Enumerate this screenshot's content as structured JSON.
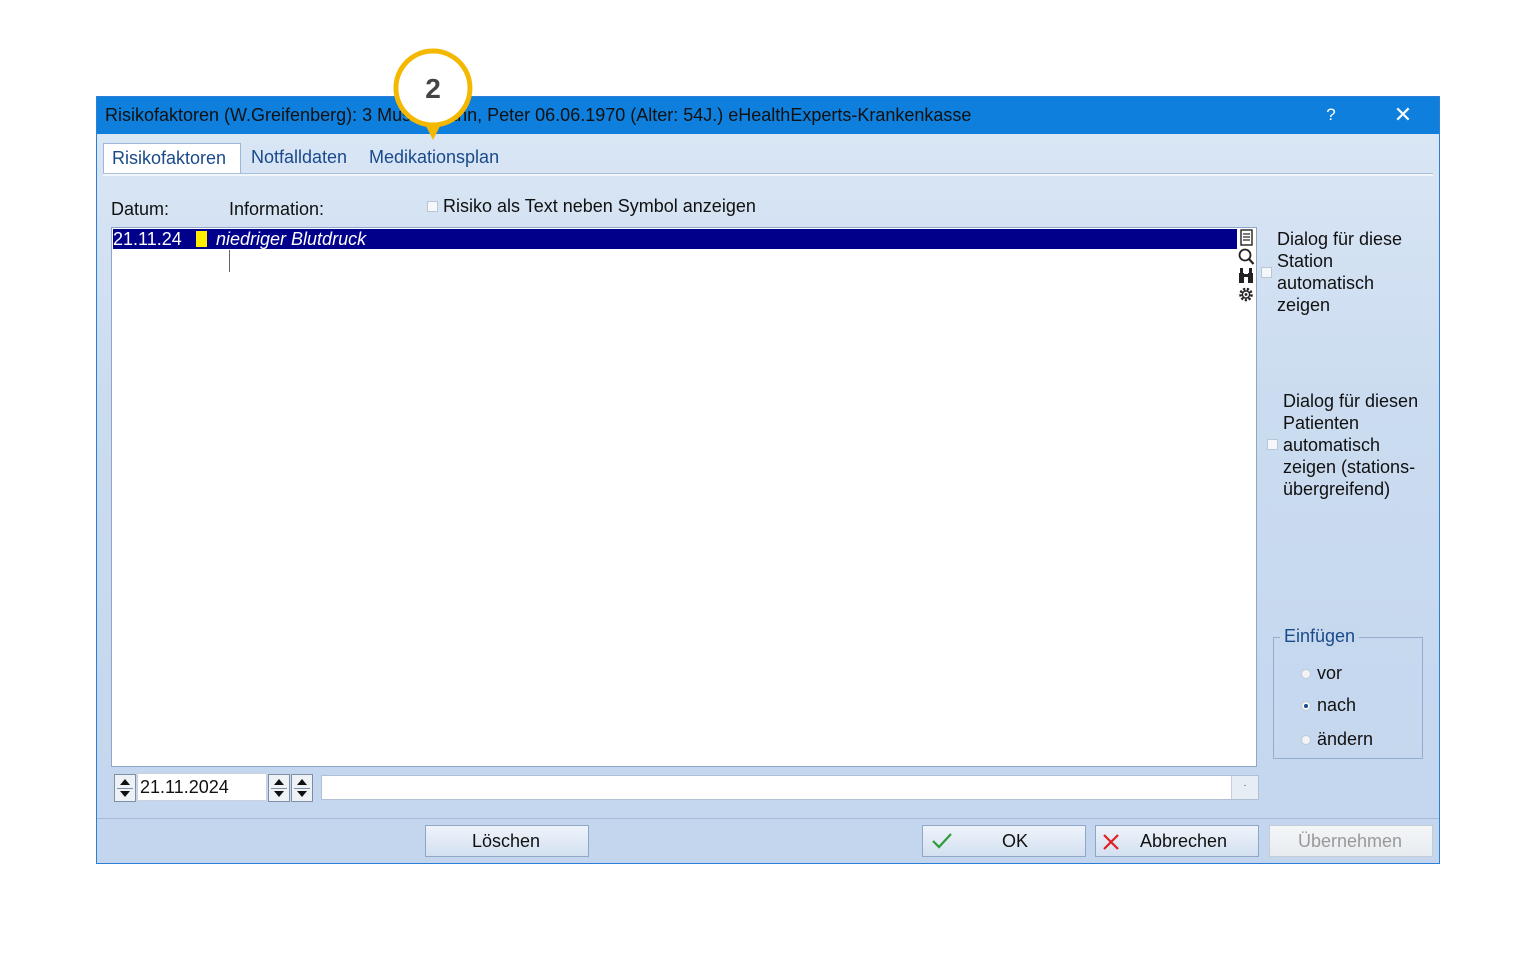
{
  "window": {
    "title": "Risikofaktoren (W.Greifenberg): 3  Mustermann, Peter 06.06.1970  (Alter: 54J.)  eHealthExperts-Krankenkasse",
    "help_label": "?",
    "close_label": "✕"
  },
  "tabs": [
    {
      "label": "Risikofaktoren",
      "active": true
    },
    {
      "label": "Notfalldaten",
      "active": false
    },
    {
      "label": "Medikationsplan",
      "active": false
    }
  ],
  "columns": {
    "date_label": "Datum:",
    "info_label": "Information:"
  },
  "show_text_option": {
    "label": "Risiko als Text neben Symbol anzeigen",
    "checked": false
  },
  "risk_list": {
    "rows": [
      {
        "date": "21.11.24",
        "symbol_color": "#ffee00",
        "text": "niedriger Blutdruck",
        "selected": true
      }
    ]
  },
  "side_icons": [
    "document-icon",
    "magnifier-icon",
    "binoculars-icon",
    "gear-icon"
  ],
  "station_option": {
    "label": "Dialog für diese Station automatisch zeigen",
    "checked": false
  },
  "patient_option": {
    "label": "Dialog für diesen Patienten automatisch zeigen (stations-übergreifend)",
    "checked": false
  },
  "insert_group": {
    "legend": "Einfügen",
    "options": [
      {
        "label": "vor",
        "selected": false
      },
      {
        "label": "nach",
        "selected": true
      },
      {
        "label": "ändern",
        "selected": false
      }
    ]
  },
  "date_input": {
    "value": "21.11.2024"
  },
  "text_input": {
    "value": "",
    "dropdown_label": "·"
  },
  "buttons": {
    "delete": "Löschen",
    "ok": "OK",
    "cancel": "Abbrechen",
    "apply": "Übernehmen"
  },
  "callout": {
    "number": "2",
    "color": "#f5b800"
  },
  "colors": {
    "titlebar": "#0e7fdc",
    "selection": "#00008b",
    "accent": "#1a4a8a"
  }
}
